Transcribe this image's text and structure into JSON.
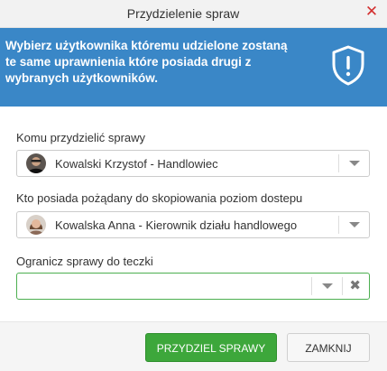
{
  "dialog": {
    "title": "Przydzielenie spraw",
    "close_symbol": "✕"
  },
  "banner": {
    "text": "Wybierz użytkownika któremu udzielone zostaną te same uprawnienia które posiada drugi z wybranych użytkowników.",
    "icon": "shield-exclamation-icon",
    "color": "#3a87c7"
  },
  "fields": {
    "assign_to": {
      "label": "Komu przydzielić sprawy",
      "value": "Kowalski Krzystof - Handlowiec",
      "avatar": "avatar-man-icon"
    },
    "copy_from": {
      "label": "Kto posiada pożądany do skopiowania poziom dostepu",
      "value": "Kowalska Anna - Kierownik działu handlowego",
      "avatar": "avatar-woman-icon"
    },
    "folder": {
      "label": "Ogranicz sprawy do teczki",
      "value": "",
      "clear_symbol": "✖"
    }
  },
  "footer": {
    "assign_label": "PRZYDZIEL SPRAWY",
    "close_label": "ZAMKNIJ",
    "assign_color": "#3da73b"
  }
}
